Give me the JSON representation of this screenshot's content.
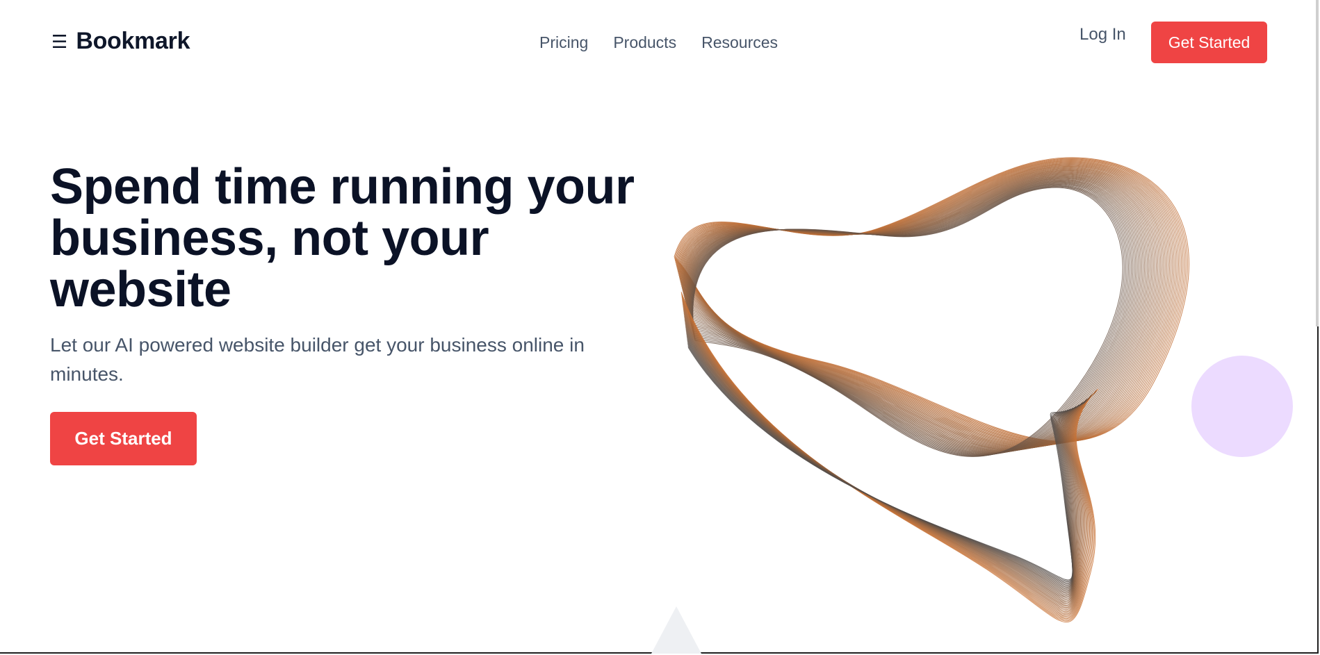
{
  "header": {
    "brand_icon": "☰",
    "brand_name": "Bookmark",
    "nav": [
      "Pricing",
      "Products",
      "Resources"
    ],
    "login": "Log In",
    "cta": "Get Started"
  },
  "hero": {
    "title": "Spend time running your business, not your website",
    "subtitle": "Let our AI powered website builder get your business online in minutes.",
    "cta": "Get Started"
  },
  "colors": {
    "accent": "#ef4444",
    "heading": "#0b1226",
    "muted": "#475569",
    "blob": "#e9d5ff",
    "wave_start": "#e07a32",
    "wave_end": "#4a4a4a"
  },
  "icons": {
    "brand": "menu-icon",
    "art": "wave-mesh-illustration"
  }
}
